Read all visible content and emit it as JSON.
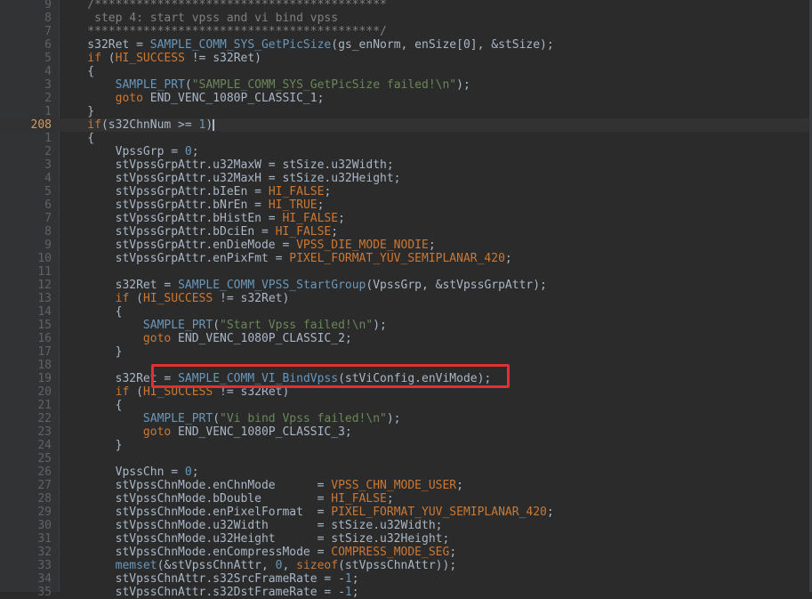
{
  "editor": {
    "current_line_number": "208",
    "accent_color": "#e03030",
    "lines": [
      {
        "n": "9",
        "t": [
          {
            "c": "tok-comment",
            "s": "    /******************************************"
          }
        ]
      },
      {
        "n": "8",
        "t": [
          {
            "c": "tok-comment",
            "s": "     step 4: start vpss and vi bind vpss"
          }
        ]
      },
      {
        "n": "7",
        "t": [
          {
            "c": "tok-comment",
            "s": "    ******************************************/"
          }
        ]
      },
      {
        "n": "6",
        "t": [
          {
            "c": "",
            "s": "    s32Ret = "
          },
          {
            "c": "tok-fn",
            "s": "SAMPLE_COMM_SYS_GetPicSize"
          },
          {
            "c": "",
            "s": "(gs_enNorm, enSize[0], &stSize);"
          }
        ]
      },
      {
        "n": "5",
        "t": [
          {
            "c": "tok-kw",
            "s": "    if"
          },
          {
            "c": "",
            "s": " ("
          },
          {
            "c": "tok-const",
            "s": "HI_SUCCESS"
          },
          {
            "c": "",
            "s": " != s32Ret)"
          }
        ]
      },
      {
        "n": "4",
        "t": [
          {
            "c": "",
            "s": "    {"
          }
        ]
      },
      {
        "n": "3",
        "t": [
          {
            "c": "tok-fn",
            "s": "        SAMPLE_PRT"
          },
          {
            "c": "",
            "s": "("
          },
          {
            "c": "tok-str",
            "s": "\"SAMPLE_COMM_SYS_GetPicSize failed!\\n\""
          },
          {
            "c": "",
            "s": ");"
          }
        ]
      },
      {
        "n": "2",
        "t": [
          {
            "c": "tok-kw",
            "s": "        goto"
          },
          {
            "c": "",
            "s": " END_VENC_1080P_CLASSIC_1;"
          }
        ]
      },
      {
        "n": "1",
        "t": [
          {
            "c": "",
            "s": "    }"
          }
        ]
      },
      {
        "n": "208",
        "current": true,
        "t": [
          {
            "c": "tok-kw",
            "s": "    if"
          },
          {
            "c": "",
            "s": "(s32ChnNum >= "
          },
          {
            "c": "tok-fn",
            "s": "1"
          },
          {
            "c": "",
            "s": ")"
          }
        ]
      },
      {
        "n": "1",
        "t": [
          {
            "c": "",
            "s": "    {"
          }
        ]
      },
      {
        "n": "2",
        "t": [
          {
            "c": "",
            "s": "        VpssGrp = "
          },
          {
            "c": "tok-fn",
            "s": "0"
          },
          {
            "c": "",
            "s": ";"
          }
        ]
      },
      {
        "n": "3",
        "t": [
          {
            "c": "",
            "s": "        stVpssGrpAttr.u32MaxW = stSize.u32Width;"
          }
        ]
      },
      {
        "n": "4",
        "t": [
          {
            "c": "",
            "s": "        stVpssGrpAttr.u32MaxH = stSize.u32Height;"
          }
        ]
      },
      {
        "n": "5",
        "t": [
          {
            "c": "",
            "s": "        stVpssGrpAttr.bIeEn = "
          },
          {
            "c": "tok-const",
            "s": "HI_FALSE"
          },
          {
            "c": "",
            "s": ";"
          }
        ]
      },
      {
        "n": "6",
        "t": [
          {
            "c": "",
            "s": "        stVpssGrpAttr.bNrEn = "
          },
          {
            "c": "tok-const",
            "s": "HI_TRUE"
          },
          {
            "c": "",
            "s": ";"
          }
        ]
      },
      {
        "n": "7",
        "t": [
          {
            "c": "",
            "s": "        stVpssGrpAttr.bHistEn = "
          },
          {
            "c": "tok-const",
            "s": "HI_FALSE"
          },
          {
            "c": "",
            "s": ";"
          }
        ]
      },
      {
        "n": "8",
        "t": [
          {
            "c": "",
            "s": "        stVpssGrpAttr.bDciEn = "
          },
          {
            "c": "tok-const",
            "s": "HI_FALSE"
          },
          {
            "c": "",
            "s": ";"
          }
        ]
      },
      {
        "n": "9",
        "t": [
          {
            "c": "",
            "s": "        stVpssGrpAttr.enDieMode = "
          },
          {
            "c": "tok-const",
            "s": "VPSS_DIE_MODE_NODIE"
          },
          {
            "c": "",
            "s": ";"
          }
        ]
      },
      {
        "n": "10",
        "t": [
          {
            "c": "",
            "s": "        stVpssGrpAttr.enPixFmt = "
          },
          {
            "c": "tok-const",
            "s": "PIXEL_FORMAT_YUV_SEMIPLANAR_420"
          },
          {
            "c": "",
            "s": ";"
          }
        ]
      },
      {
        "n": "11",
        "t": [
          {
            "c": "",
            "s": ""
          }
        ]
      },
      {
        "n": "12",
        "t": [
          {
            "c": "",
            "s": "        s32Ret = "
          },
          {
            "c": "tok-fn",
            "s": "SAMPLE_COMM_VPSS_StartGroup"
          },
          {
            "c": "",
            "s": "(VpssGrp, &stVpssGrpAttr);"
          }
        ]
      },
      {
        "n": "13",
        "t": [
          {
            "c": "tok-kw",
            "s": "        if"
          },
          {
            "c": "",
            "s": " ("
          },
          {
            "c": "tok-const",
            "s": "HI_SUCCESS"
          },
          {
            "c": "",
            "s": " != s32Ret)"
          }
        ]
      },
      {
        "n": "14",
        "t": [
          {
            "c": "",
            "s": "        {"
          }
        ]
      },
      {
        "n": "15",
        "t": [
          {
            "c": "tok-fn",
            "s": "            SAMPLE_PRT"
          },
          {
            "c": "",
            "s": "("
          },
          {
            "c": "tok-str",
            "s": "\"Start Vpss failed!\\n\""
          },
          {
            "c": "",
            "s": ");"
          }
        ]
      },
      {
        "n": "16",
        "t": [
          {
            "c": "tok-kw",
            "s": "            goto"
          },
          {
            "c": "",
            "s": " END_VENC_1080P_CLASSIC_2;"
          }
        ]
      },
      {
        "n": "17",
        "t": [
          {
            "c": "",
            "s": "        }"
          }
        ]
      },
      {
        "n": "18",
        "t": [
          {
            "c": "",
            "s": ""
          }
        ]
      },
      {
        "n": "19",
        "t": [
          {
            "c": "",
            "s": "        s32Ret = "
          },
          {
            "c": "tok-fn",
            "s": "SAMPLE_COMM_VI_BindVpss"
          },
          {
            "c": "",
            "s": "(stViConfig.enViMode);"
          }
        ]
      },
      {
        "n": "20",
        "t": [
          {
            "c": "tok-kw",
            "s": "        if"
          },
          {
            "c": "",
            "s": " ("
          },
          {
            "c": "tok-const",
            "s": "HI_SUCCESS"
          },
          {
            "c": "",
            "s": " != s32Ret)"
          }
        ]
      },
      {
        "n": "21",
        "t": [
          {
            "c": "",
            "s": "        {"
          }
        ]
      },
      {
        "n": "22",
        "t": [
          {
            "c": "tok-fn",
            "s": "            SAMPLE_PRT"
          },
          {
            "c": "",
            "s": "("
          },
          {
            "c": "tok-str",
            "s": "\"Vi bind Vpss failed!\\n\""
          },
          {
            "c": "",
            "s": ");"
          }
        ]
      },
      {
        "n": "23",
        "t": [
          {
            "c": "tok-kw",
            "s": "            goto"
          },
          {
            "c": "",
            "s": " END_VENC_1080P_CLASSIC_3;"
          }
        ]
      },
      {
        "n": "24",
        "t": [
          {
            "c": "",
            "s": "        }"
          }
        ]
      },
      {
        "n": "25",
        "t": [
          {
            "c": "",
            "s": ""
          }
        ]
      },
      {
        "n": "26",
        "t": [
          {
            "c": "",
            "s": "        VpssChn = "
          },
          {
            "c": "tok-fn",
            "s": "0"
          },
          {
            "c": "",
            "s": ";"
          }
        ]
      },
      {
        "n": "27",
        "t": [
          {
            "c": "",
            "s": "        stVpssChnMode.enChnMode      = "
          },
          {
            "c": "tok-const",
            "s": "VPSS_CHN_MODE_USER"
          },
          {
            "c": "",
            "s": ";"
          }
        ]
      },
      {
        "n": "28",
        "t": [
          {
            "c": "",
            "s": "        stVpssChnMode.bDouble        = "
          },
          {
            "c": "tok-const",
            "s": "HI_FALSE"
          },
          {
            "c": "",
            "s": ";"
          }
        ]
      },
      {
        "n": "29",
        "t": [
          {
            "c": "",
            "s": "        stVpssChnMode.enPixelFormat  = "
          },
          {
            "c": "tok-const",
            "s": "PIXEL_FORMAT_YUV_SEMIPLANAR_420"
          },
          {
            "c": "",
            "s": ";"
          }
        ]
      },
      {
        "n": "30",
        "t": [
          {
            "c": "",
            "s": "        stVpssChnMode.u32Width       = stSize.u32Width;"
          }
        ]
      },
      {
        "n": "31",
        "t": [
          {
            "c": "",
            "s": "        stVpssChnMode.u32Height      = stSize.u32Height;"
          }
        ]
      },
      {
        "n": "32",
        "t": [
          {
            "c": "",
            "s": "        stVpssChnMode.enCompressMode = "
          },
          {
            "c": "tok-const",
            "s": "COMPRESS_MODE_SEG"
          },
          {
            "c": "",
            "s": ";"
          }
        ]
      },
      {
        "n": "33",
        "t": [
          {
            "c": "tok-fn",
            "s": "        memset"
          },
          {
            "c": "",
            "s": "(&stVpssChnAttr, "
          },
          {
            "c": "tok-fn",
            "s": "0"
          },
          {
            "c": "",
            "s": ", "
          },
          {
            "c": "tok-kw",
            "s": "sizeof"
          },
          {
            "c": "",
            "s": "(stVpssChnAttr));"
          }
        ]
      },
      {
        "n": "34",
        "t": [
          {
            "c": "",
            "s": "        stVpssChnAttr.s32SrcFrameRate = -"
          },
          {
            "c": "tok-fn",
            "s": "1"
          },
          {
            "c": "",
            "s": ";"
          }
        ]
      },
      {
        "n": "35",
        "t": [
          {
            "c": "",
            "s": "        stVpssChnAttr.s32DstFrameRate = -"
          },
          {
            "c": "tok-fn",
            "s": "1"
          },
          {
            "c": "",
            "s": ";"
          }
        ]
      }
    ]
  }
}
